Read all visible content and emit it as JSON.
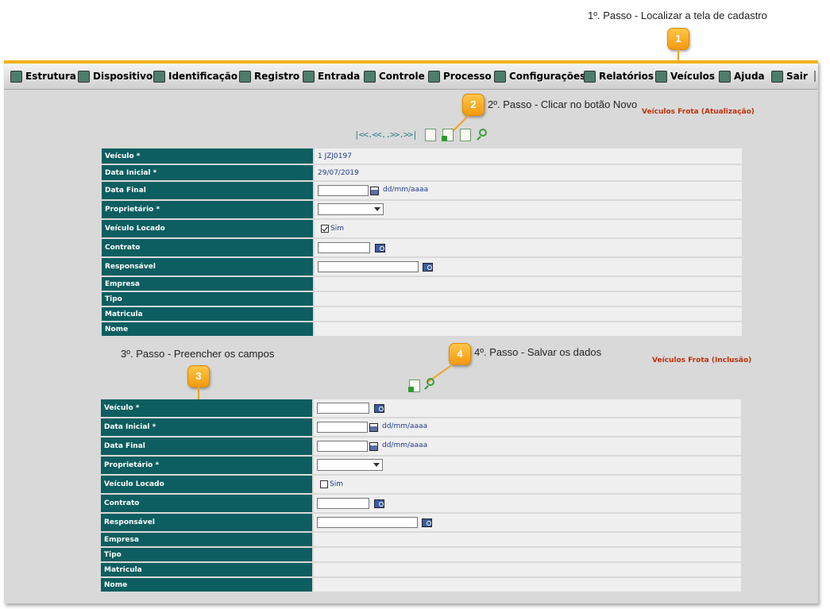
{
  "callouts": {
    "step1": {
      "number": "1",
      "text": "1º. Passo - Localizar a tela de cadastro"
    },
    "step2": {
      "number": "2",
      "text": "2º. Passo - Clicar no botão Novo"
    },
    "step3": {
      "number": "3",
      "text": "3º. Passo - Preencher os campos"
    },
    "step4": {
      "number": "4",
      "text": "4º. Passo - Salvar os dados"
    }
  },
  "menu": {
    "items": [
      "Estrutura",
      "Dispositivo",
      "Identificação",
      "Registro",
      "Entrada",
      "Controle",
      "Processo",
      "Configurações",
      "Relatórios",
      "Veículos",
      "Ajuda",
      "Sair"
    ]
  },
  "form_update": {
    "title": "Veículos Frota (Atualização)",
    "nav": "|<<.<<..>>.>>|",
    "rows": {
      "veiculo": {
        "label": "Veículo *",
        "value": "1 JZJ0197"
      },
      "data_inicial": {
        "label": "Data Inicial *",
        "value": "29/07/2019"
      },
      "data_final": {
        "label": "Data Final",
        "format": "dd/mm/aaaa"
      },
      "proprietario": {
        "label": "Proprietário *"
      },
      "veiculo_locado": {
        "label": "Veículo Locado",
        "option": "Sim",
        "checked": true
      },
      "contrato": {
        "label": "Contrato"
      },
      "responsavel": {
        "label": "Responsável"
      },
      "empresa": {
        "label": "Empresa"
      },
      "tipo": {
        "label": "Tipo"
      },
      "matricula": {
        "label": "Matricula"
      },
      "nome": {
        "label": "Nome"
      }
    }
  },
  "form_insert": {
    "title": "Veículos Frota (Inclusão)",
    "rows": {
      "veiculo": {
        "label": "Veículo *"
      },
      "data_inicial": {
        "label": "Data Inicial *",
        "format": "dd/mm/aaaa"
      },
      "data_final": {
        "label": "Data Final",
        "format": "dd/mm/aaaa"
      },
      "proprietario": {
        "label": "Proprietário *"
      },
      "veiculo_locado": {
        "label": "Veículo Locado",
        "option": "Sim",
        "checked": false
      },
      "contrato": {
        "label": "Contrato"
      },
      "responsavel": {
        "label": "Responsável"
      },
      "empresa": {
        "label": "Empresa"
      },
      "tipo": {
        "label": "Tipo"
      },
      "matricula": {
        "label": "Matricula"
      },
      "nome": {
        "label": "Nome"
      }
    }
  },
  "colors": {
    "header": "#0d5e60",
    "accent": "#f3b21b",
    "title_red": "#c0300a",
    "value_blue": "#1f3c8c"
  }
}
